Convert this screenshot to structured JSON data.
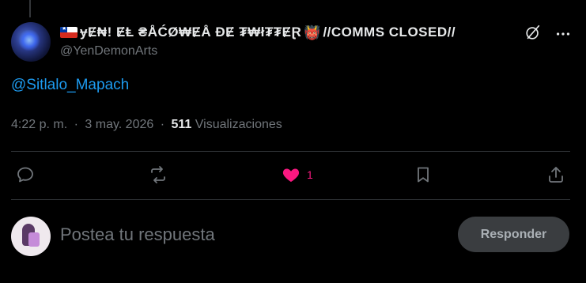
{
  "tweet": {
    "author": {
      "flag": "Chile",
      "display_name": "ɏɆ₦! ɆⱠ ₴ÅĆØ₩ɆÅ ĐɆ ₮₩ł₮₮ɆⱤ",
      "display_name_suffix": "//COMMS CLOSED//",
      "oni_emoji": "👹",
      "handle": "@YenDemonArts"
    },
    "mention": "@Sitlalo_Mapach",
    "time": "4:22 p. m.",
    "separator": "·",
    "date": "3 may. 2026",
    "views_count": "511",
    "views_label": "Visualizaciones"
  },
  "actions": {
    "reply_icon": "reply-bubble-icon",
    "repost_icon": "repost-arrows-icon",
    "like_icon": "heart-filled-icon",
    "like_count": "1",
    "bookmark_icon": "bookmark-icon",
    "share_icon": "share-upload-icon"
  },
  "composer": {
    "placeholder": "Postea tu respuesta",
    "button_label": "Responder"
  },
  "colors": {
    "background": "#000000",
    "accent_link": "#1d9bf0",
    "like_pink": "#f91880",
    "muted_text": "#71767b",
    "primary_text": "#e7e9ea"
  }
}
